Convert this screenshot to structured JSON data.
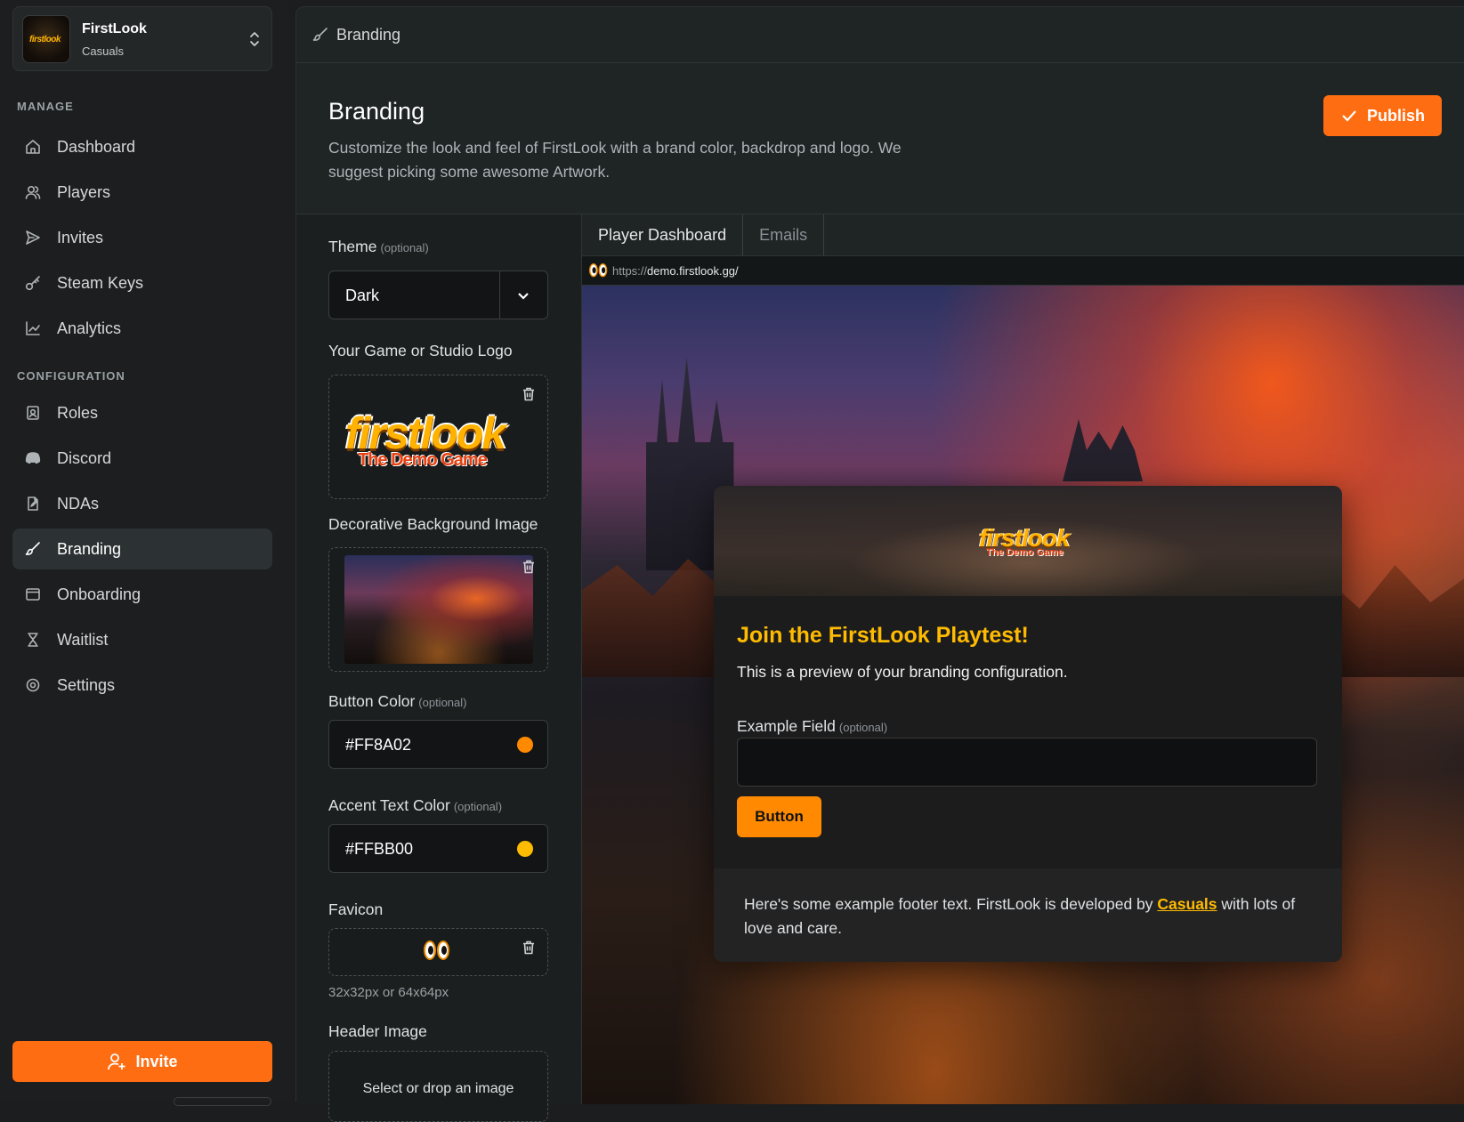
{
  "team": {
    "name": "FirstLook",
    "subtitle": "Casuals"
  },
  "sidebar": {
    "manage_label": "MANAGE",
    "config_label": "CONFIGURATION",
    "manage_items": [
      {
        "label": "Dashboard",
        "icon": "home-icon"
      },
      {
        "label": "Players",
        "icon": "users-icon"
      },
      {
        "label": "Invites",
        "icon": "send-icon"
      },
      {
        "label": "Steam Keys",
        "icon": "key-icon"
      },
      {
        "label": "Analytics",
        "icon": "chart-icon"
      }
    ],
    "config_items": [
      {
        "label": "Roles",
        "icon": "badge-icon"
      },
      {
        "label": "Discord",
        "icon": "discord-icon"
      },
      {
        "label": "NDAs",
        "icon": "document-icon"
      },
      {
        "label": "Branding",
        "icon": "brush-icon",
        "active": true
      },
      {
        "label": "Onboarding",
        "icon": "window-icon"
      },
      {
        "label": "Waitlist",
        "icon": "hourglass-icon"
      },
      {
        "label": "Settings",
        "icon": "gear-icon"
      }
    ],
    "invite_label": "Invite"
  },
  "breadcrumb": {
    "label": "Branding"
  },
  "page": {
    "title": "Branding",
    "description": "Customize the look and feel of FirstLook with a brand color, backdrop and logo. We suggest picking some awesome Artwork.",
    "publish_label": "Publish"
  },
  "form": {
    "theme": {
      "label": "Theme",
      "optional": "(optional)",
      "value": "Dark"
    },
    "logo": {
      "label": "Your Game or Studio Logo",
      "art_word": "firstlook",
      "art_sub": "The Demo Game"
    },
    "background": {
      "label": "Decorative Background Image"
    },
    "button_color": {
      "label": "Button Color",
      "optional": "(optional)",
      "value": "#FF8A02",
      "swatch": "#FF8A02"
    },
    "accent_color": {
      "label": "Accent Text Color",
      "optional": "(optional)",
      "value": "#FFBB00",
      "swatch": "#FFBB00"
    },
    "favicon": {
      "label": "Favicon",
      "hint": "32x32px or 64x64px"
    },
    "header_image": {
      "label": "Header Image",
      "drop_text": "Select or drop an image"
    }
  },
  "preview": {
    "tabs": [
      "Player Dashboard",
      "Emails"
    ],
    "url_prefix": "https://",
    "url_host": "demo.firstlook.gg/",
    "card": {
      "logo_word": "firstlook",
      "logo_sub": "The Demo Game",
      "title": "Join the FirstLook Playtest!",
      "subtitle": "This is a preview of your branding configuration.",
      "field_label": "Example Field",
      "field_optional": "(optional)",
      "button_label": "Button",
      "footer_before": "Here's some example footer text. FirstLook is developed by ",
      "footer_link": "Casuals",
      "footer_after": " with lots of love and care."
    }
  },
  "colors": {
    "accent": "#FF6D12",
    "button": "#FF8A02",
    "accent_text": "#FFBB00"
  }
}
